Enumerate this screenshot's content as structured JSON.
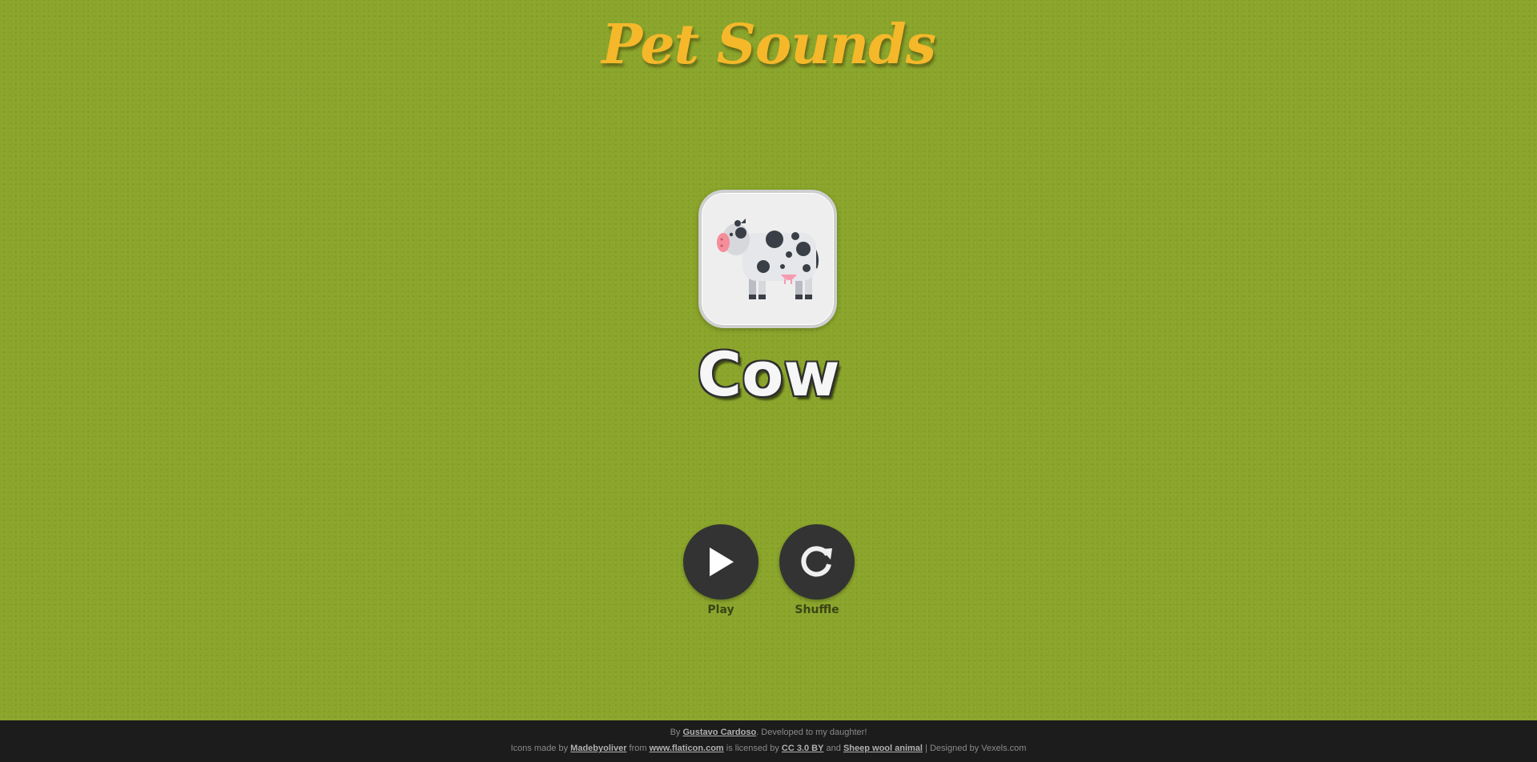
{
  "app": {
    "title": "Pet Sounds"
  },
  "card": {
    "animal_name": "Cow",
    "icon": "cow-icon"
  },
  "controls": {
    "play_label": "Play",
    "play_icon": "play-icon",
    "shuffle_label": "Shuffle",
    "shuffle_icon": "refresh-icon"
  },
  "footer": {
    "line1_prefix": "By",
    "author_link": "Gustavo Cardoso",
    "line1_suffix": ". Developed to my daughter!",
    "icons_prefix": "Icons made by",
    "madebyoliver_link": "Madebyoliver",
    "from_text": "from",
    "flaticon_link": "www.flaticon.com",
    "licensed_text": "is licensed by",
    "license_link": "CC 3.0 BY",
    "and_text": "and",
    "sheep_link": "Sheep wool animal",
    "designed_text": "| Designed by Vexels.com"
  },
  "colors": {
    "background": "#8aa52a",
    "logo": "#f5b82a",
    "button": "#333333",
    "footer": "#1c1c1c"
  }
}
